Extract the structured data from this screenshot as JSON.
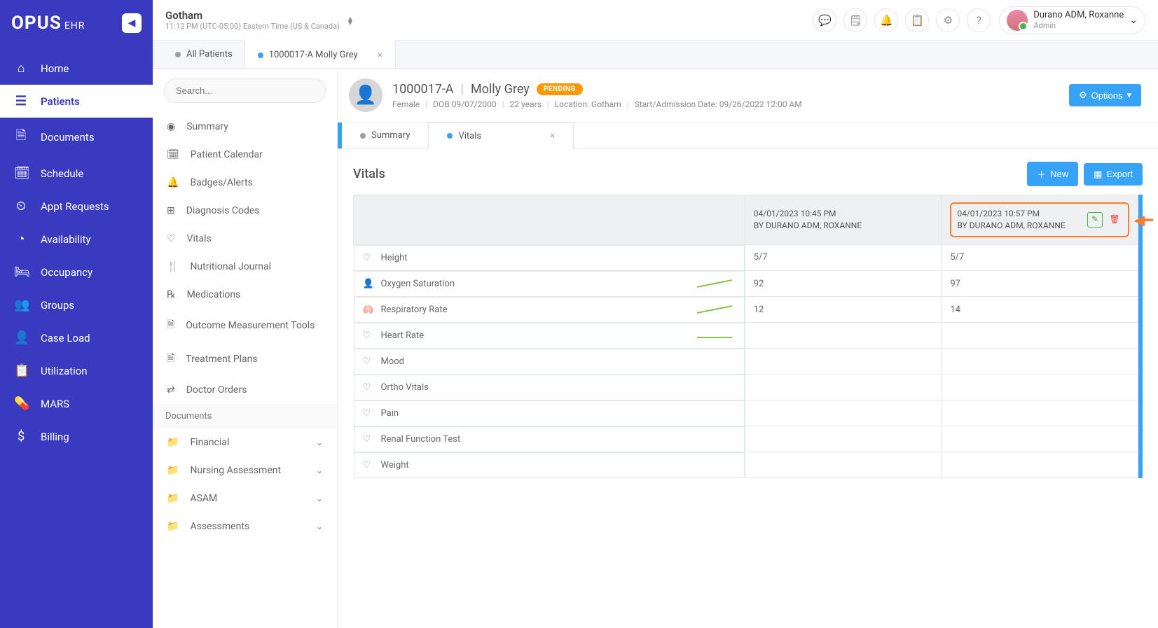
{
  "brand": {
    "name": "OPUS",
    "suffix": "EHR"
  },
  "topbar": {
    "location_name": "Gotham",
    "timezone": "11:12 PM (UTC-05:00) Eastern Time (US & Canada)",
    "user_name": "Durano ADM, Roxanne",
    "user_role": "Admin"
  },
  "nav": [
    {
      "icon": "⌂",
      "label": "Home"
    },
    {
      "icon": "☰",
      "label": "Patients",
      "active": true
    },
    {
      "icon": "🗎",
      "label": "Documents"
    },
    {
      "icon": "🗓",
      "label": "Schedule"
    },
    {
      "icon": "⏲",
      "label": "Appt Requests"
    },
    {
      "icon": "◔",
      "label": "Availability"
    },
    {
      "icon": "🛏",
      "label": "Occupancy"
    },
    {
      "icon": "👥",
      "label": "Groups"
    },
    {
      "icon": "👤",
      "label": "Case Load"
    },
    {
      "icon": "📋",
      "label": "Utilization"
    },
    {
      "icon": "💊",
      "label": "MARS"
    },
    {
      "icon": "$",
      "label": "Billing"
    }
  ],
  "outer_tabs": [
    {
      "label": "All Patients"
    },
    {
      "label": "1000017-A Molly Grey",
      "active": true,
      "closable": true
    }
  ],
  "search_placeholder": "Search...",
  "sub_nav": [
    {
      "icon": "◉",
      "label": "Summary"
    },
    {
      "icon": "🗓",
      "label": "Patient Calendar"
    },
    {
      "icon": "🔔",
      "label": "Badges/Alerts"
    },
    {
      "icon": "⊞",
      "label": "Diagnosis Codes"
    },
    {
      "icon": "♡",
      "label": "Vitals"
    },
    {
      "icon": "🍴",
      "label": "Nutritional Journal"
    },
    {
      "icon": "℞",
      "label": "Medications"
    },
    {
      "icon": "🗎",
      "label": "Outcome Measurement Tools"
    },
    {
      "icon": "🗎",
      "label": "Treatment Plans"
    },
    {
      "icon": "⇄",
      "label": "Doctor Orders"
    },
    {
      "section": "Documents"
    },
    {
      "icon": "📁",
      "label": "Financial",
      "expandable": true
    },
    {
      "icon": "📁",
      "label": "Nursing Assessment",
      "expandable": true
    },
    {
      "icon": "📁",
      "label": "ASAM",
      "expandable": true
    },
    {
      "icon": "📁",
      "label": "Assessments",
      "expandable": true
    }
  ],
  "patient": {
    "id": "1000017-A",
    "name": "Molly Grey",
    "status": "PENDING",
    "gender": "Female",
    "dob": "DOB 09/07/2000",
    "age": "22 years",
    "location": "Location: Gotham",
    "admission": "Start/Admission Date: 09/26/2022 12:00 AM",
    "options_label": "Options"
  },
  "inner_tabs": [
    {
      "label": "Summary"
    },
    {
      "label": "Vitals",
      "active": true,
      "closable": true
    }
  ],
  "vitals": {
    "title": "Vitals",
    "new_label": "New",
    "export_label": "Export",
    "columns": [
      {
        "timestamp": "04/01/2023 10:45 PM",
        "by": "BY DURANO ADM, ROXANNE"
      },
      {
        "timestamp": "04/01/2023 10:57 PM",
        "by": "BY DURANO ADM, ROXANNE",
        "highlighted": true
      }
    ],
    "rows": [
      {
        "icon": "♡",
        "label": "Height",
        "values": [
          "5/7",
          "5/7"
        ],
        "spark": false
      },
      {
        "icon": "👤",
        "label": "Oxygen Saturation",
        "values": [
          "92",
          "97"
        ],
        "spark": true
      },
      {
        "icon": "🫁",
        "label": "Respiratory Rate",
        "values": [
          "12",
          "14"
        ],
        "spark": true
      },
      {
        "icon": "♡",
        "label": "Heart Rate",
        "values": [
          "",
          ""
        ],
        "spark": true,
        "flat": true
      },
      {
        "icon": "♡",
        "label": "Mood",
        "values": [
          "",
          ""
        ]
      },
      {
        "icon": "♡",
        "label": "Ortho Vitals",
        "values": [
          "",
          ""
        ]
      },
      {
        "icon": "♡",
        "label": "Pain",
        "values": [
          "",
          ""
        ]
      },
      {
        "icon": "♡",
        "label": "Renal Function Test",
        "values": [
          "",
          ""
        ]
      },
      {
        "icon": "♡",
        "label": "Weight",
        "values": [
          "",
          ""
        ]
      }
    ]
  }
}
